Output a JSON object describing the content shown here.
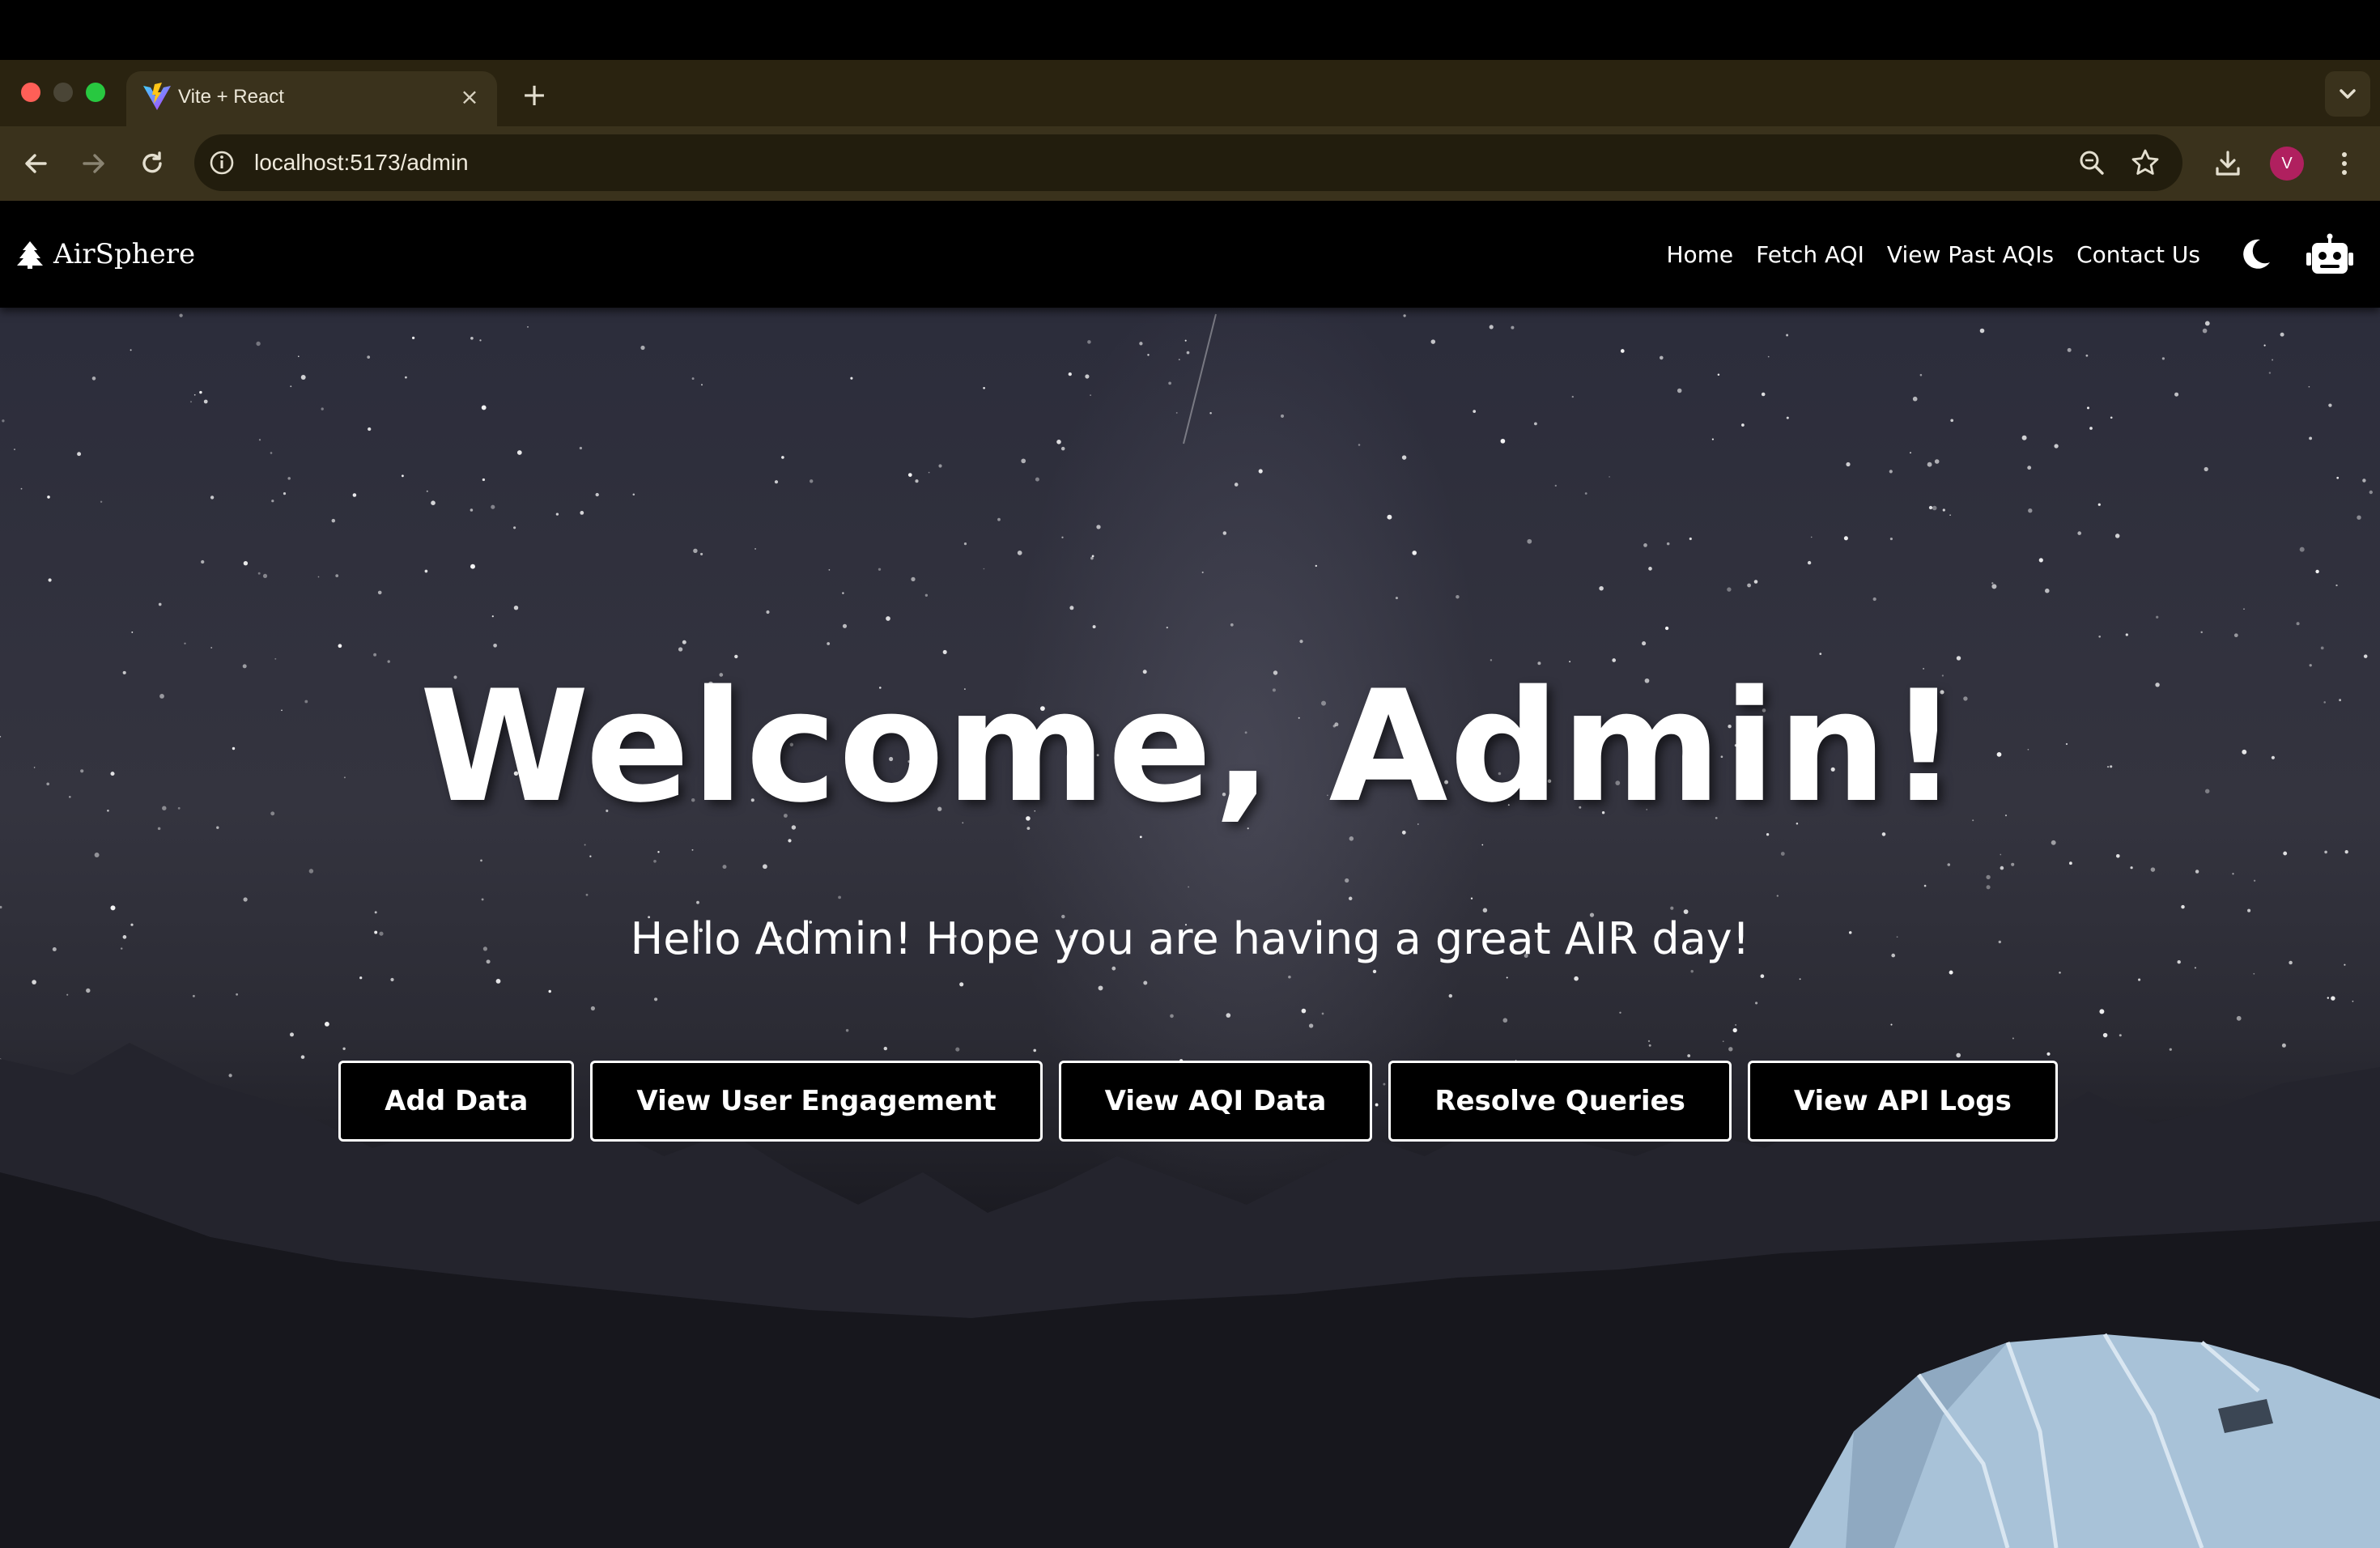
{
  "browser": {
    "tab_title": "Vite + React",
    "tab_close": "×",
    "new_tab": "+",
    "url": "localhost:5173/admin",
    "profile_initial": "V",
    "icons": [
      "back-arrow-icon",
      "forward-arrow-icon",
      "reload-icon",
      "site-info-icon",
      "zoom-icon",
      "bookmark-star-icon",
      "download-icon",
      "kebab-menu-icon",
      "tab-search-chevron-icon"
    ]
  },
  "navbar": {
    "brand": "AirSphere",
    "brand_icon": "tree-icon",
    "links": [
      "Home",
      "Fetch AQI",
      "View Past AQIs",
      "Contact Us"
    ],
    "theme_icon": "moon-icon",
    "chatbot_icon": "robot-icon"
  },
  "hero": {
    "title": "Welcome, Admin!",
    "subtitle": "Hello Admin! Hope you are having a great AIR day!",
    "buttons": [
      "Add Data",
      "View User Engagement",
      "View AQI Data",
      "Resolve Queries",
      "View API Logs"
    ]
  },
  "colors": {
    "tabstrip": "#2a2310",
    "toolbar": "#3a321c",
    "navbar": "#000000",
    "button_bg": "#000000",
    "button_border": "#ffffff",
    "avatar": "#b0205f"
  }
}
